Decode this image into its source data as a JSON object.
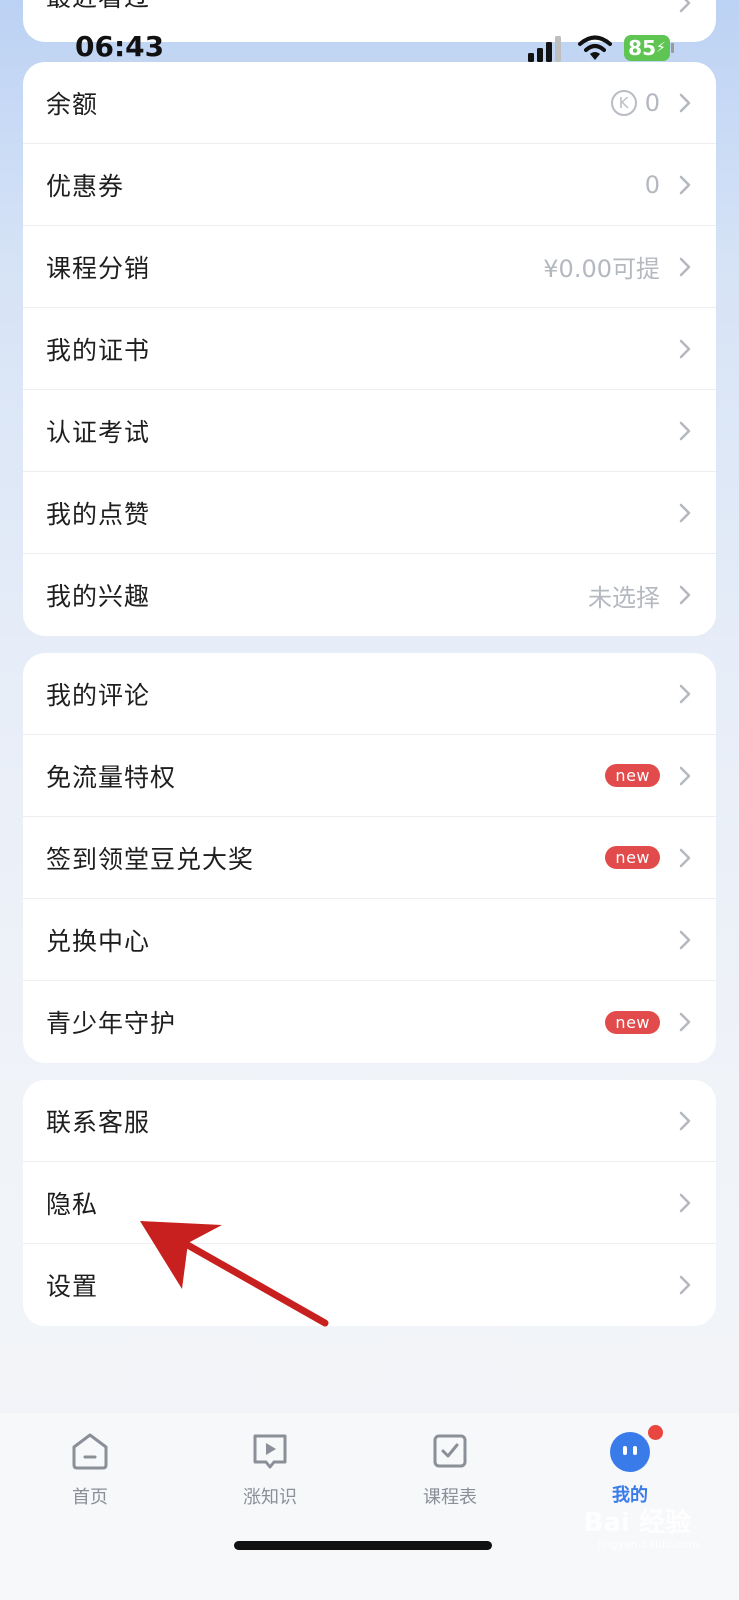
{
  "top_partial": {
    "label": "最近看过"
  },
  "status_bar": {
    "time": "06:43",
    "battery": "85"
  },
  "group1": [
    {
      "label": "余额",
      "value": "0",
      "has_k_icon": true
    },
    {
      "label": "优惠券",
      "value": "0"
    },
    {
      "label": "课程分销",
      "value": "¥0.00可提"
    },
    {
      "label": "我的证书",
      "value": ""
    },
    {
      "label": "认证考试",
      "value": ""
    },
    {
      "label": "我的点赞",
      "value": ""
    },
    {
      "label": "我的兴趣",
      "value": "未选择"
    }
  ],
  "group2": [
    {
      "label": "我的评论",
      "badge": ""
    },
    {
      "label": "免流量特权",
      "badge": "new"
    },
    {
      "label": "签到领堂豆兑大奖",
      "badge": "new"
    },
    {
      "label": "兑换中心",
      "badge": ""
    },
    {
      "label": "青少年守护",
      "badge": "new"
    }
  ],
  "group3": [
    {
      "label": "联系客服"
    },
    {
      "label": "隐私"
    },
    {
      "label": "设置"
    }
  ],
  "tabs": [
    {
      "label": "首页",
      "icon": "home-icon"
    },
    {
      "label": "涨知识",
      "icon": "play-icon"
    },
    {
      "label": "课程表",
      "icon": "check-icon"
    },
    {
      "label": "我的",
      "icon": "face-icon",
      "active": true
    }
  ],
  "watermark": {
    "text": "Bai 经验",
    "sub": "jingyan.baidu.com"
  },
  "colors": {
    "accent": "#3a7bea",
    "badge": "#e14b4b",
    "arrow": "#c8201e"
  }
}
